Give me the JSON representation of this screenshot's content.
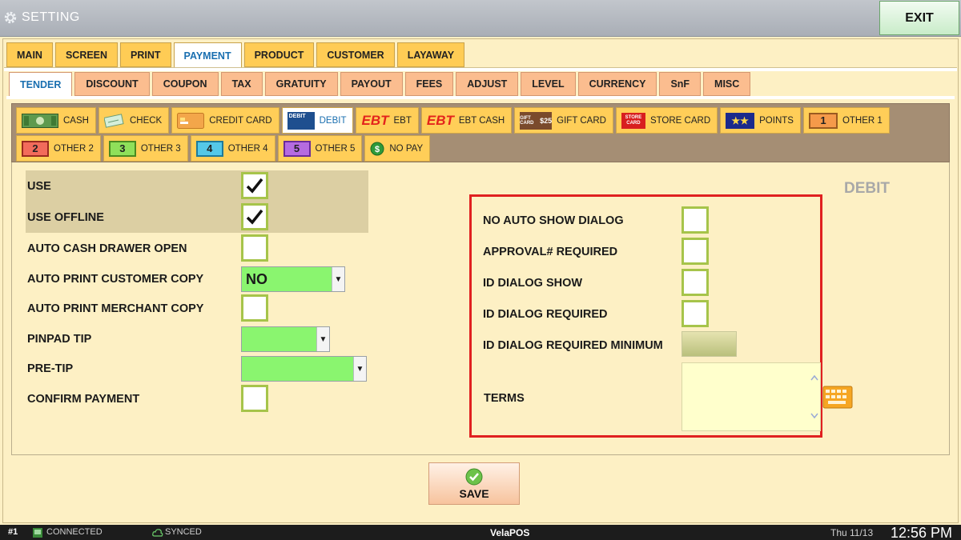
{
  "window": {
    "title": "SETTING",
    "exit_label": "EXIT"
  },
  "main_tabs": [
    "MAIN",
    "SCREEN",
    "PRINT",
    "PAYMENT",
    "PRODUCT",
    "CUSTOMER",
    "LAYAWAY"
  ],
  "main_tab_active": "PAYMENT",
  "sub_tabs": [
    "TENDER",
    "DISCOUNT",
    "COUPON",
    "TAX",
    "GRATUITY",
    "PAYOUT",
    "FEES",
    "ADJUST",
    "LEVEL",
    "CURRENCY",
    "SnF",
    "MISC"
  ],
  "sub_tab_active": "TENDER",
  "payment_types": {
    "row1": [
      "CASH",
      "CHECK",
      "CREDIT CARD",
      "DEBIT",
      "EBT",
      "EBT CASH",
      "GIFT CARD",
      "STORE CARD",
      "POINTS",
      "OTHER 1"
    ],
    "row2": [
      "OTHER 2",
      "OTHER 3",
      "OTHER 4",
      "OTHER 5",
      "NO PAY"
    ],
    "active": "DEBIT",
    "icon_text": {
      "debit": "DEBIT",
      "ebt": "EBT",
      "ebt_cash": "EBT",
      "gift": "GIFT CARD",
      "gift_amount": "$25",
      "store": "STORE CARD",
      "other1": "1",
      "other2": "2",
      "other3": "3",
      "other4": "4",
      "other5": "5"
    },
    "colors": {
      "other1": "#f59a4a",
      "other2": "#f26b5b",
      "other3": "#8fe05a",
      "other4": "#55c8e8",
      "other5": "#b56be0"
    }
  },
  "section_title": "DEBIT",
  "left_settings": [
    {
      "label": "USE",
      "checked": true
    },
    {
      "label": "USE OFFLINE",
      "checked": true
    },
    {
      "label": "AUTO CASH DRAWER OPEN",
      "checked": false
    },
    {
      "label": "AUTO PRINT CUSTOMER COPY",
      "value": "NO"
    },
    {
      "label": "AUTO PRINT MERCHANT COPY",
      "checked": false
    },
    {
      "label": "PINPAD TIP",
      "value": ""
    },
    {
      "label": "PRE-TIP",
      "value": ""
    },
    {
      "label": "CONFIRM PAYMENT",
      "checked": false
    }
  ],
  "right_settings": [
    {
      "label": "NO AUTO SHOW DIALOG",
      "checked": false
    },
    {
      "label": "APPROVAL# REQUIRED",
      "checked": false
    },
    {
      "label": "ID DIALOG SHOW",
      "checked": false
    },
    {
      "label": "ID DIALOG REQUIRED",
      "checked": false
    },
    {
      "label": "ID DIALOG REQUIRED MINIMUM",
      "value": ""
    },
    {
      "label": "TERMS",
      "value": ""
    }
  ],
  "save_label": "SAVE",
  "status": {
    "terminal": "#1",
    "connection": "CONNECTED",
    "sync": "SYNCED",
    "brand": "VelaPOS",
    "date": "Thu 11/13",
    "time": "12:56 PM"
  },
  "accent_colors": {
    "checkbox_border": "#a6c44a",
    "combo_fill": "#8af56f",
    "highlight_box": "#e02020"
  }
}
